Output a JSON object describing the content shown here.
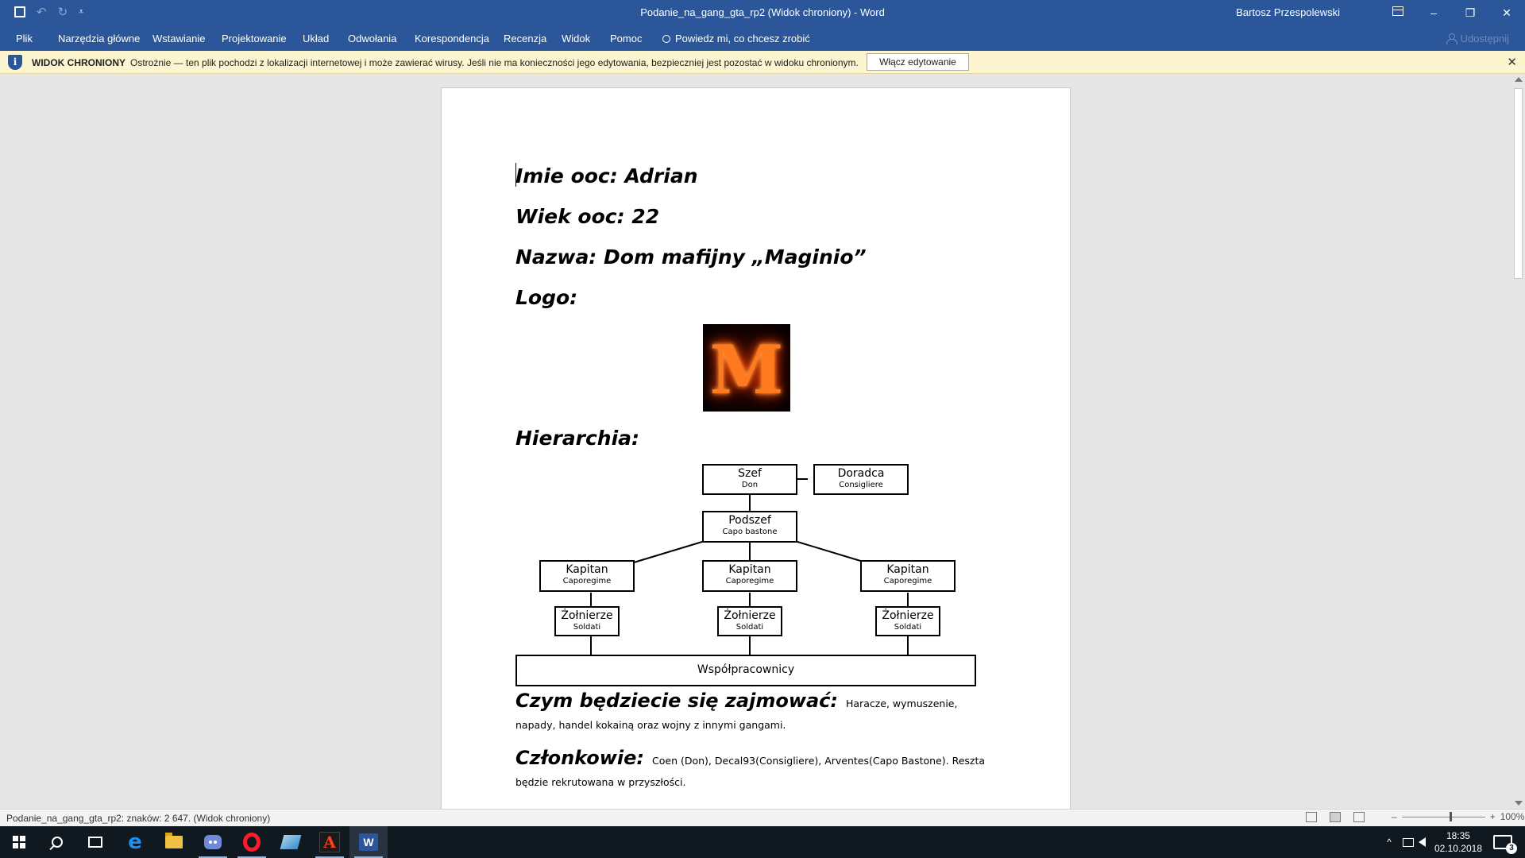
{
  "titlebar": {
    "title": "Podanie_na_gang_gta_rp2 (Widok chroniony) - Word",
    "user": "Bartosz Przespolewski",
    "minimize": "–",
    "restore": "❐",
    "close": "✕",
    "save_icon": "save-icon",
    "undo": "↶",
    "redo": "↻",
    "customize": "⩡"
  },
  "menu": {
    "items": [
      "Plik",
      "Narzędzia główne",
      "Wstawianie",
      "Projektowanie",
      "Układ",
      "Odwołania",
      "Korespondencja",
      "Recenzja",
      "Widok",
      "Pomoc"
    ],
    "tell_me": "Powiedz mi, co chcesz zrobić",
    "share": "Udostępnij"
  },
  "protected_view": {
    "title": "WIDOK CHRONIONY",
    "message": "Ostrożnie — ten plik pochodzi z lokalizacji internetowej i może zawierać wirusy. Jeśli nie ma konieczności jego edytowania, bezpieczniej jest pozostać w widoku chronionym.",
    "enable_button": "Włącz edytowanie",
    "close": "✕"
  },
  "document": {
    "lines": {
      "name": "Imie ooc: Adrian",
      "age": "Wiek ooc: 22",
      "org": "Nazwa: Dom mafijny „Maginio”",
      "logo_label": "Logo:",
      "hierarchy_label": "Hierarchia:"
    },
    "logo_letter": "M",
    "hierarchy": {
      "boss": {
        "title": "Szef",
        "sub": "Don"
      },
      "advisor": {
        "title": "Doradca",
        "sub": "Consigliere"
      },
      "underboss": {
        "title": "Podszef",
        "sub": "Capo bastone"
      },
      "captains": [
        {
          "title": "Kapitan",
          "sub": "Caporegime"
        },
        {
          "title": "Kapitan",
          "sub": "Caporegime"
        },
        {
          "title": "Kapitan",
          "sub": "Caporegime"
        }
      ],
      "soldiers": [
        {
          "title": "Żołnierze",
          "sub": "Soldati"
        },
        {
          "title": "Żołnierze",
          "sub": "Soldati"
        },
        {
          "title": "Żołnierze",
          "sub": "Soldati"
        }
      ],
      "associates": "Współpracownicy"
    },
    "activities": {
      "heading": "Czym będziecie się zajmować:",
      "text": "Haracze, wymuszenie, napady, handel kokainą oraz wojny z innymi gangami."
    },
    "members": {
      "heading": "Członkowie:",
      "text": "Coen (Don),  Decal93(Consigliere),  Arventes(Capo Bastone). Reszta będzie rekrutowana w przyszłości."
    }
  },
  "statusbar": {
    "text": "Podanie_na_gang_gta_rp2: znaków: 2 647. (Widok chroniony)",
    "zoom_out": "–",
    "zoom_in": "+",
    "zoom": "100%"
  },
  "taskbar": {
    "time": "18:35",
    "date": "02.10.2018",
    "tray_chevron": "^",
    "notifications": "3",
    "edge_glyph": "e",
    "app6_glyph": "A",
    "word_glyph": "W"
  },
  "colors": {
    "ribbon": "#2b579a",
    "protected_bar": "#fdf5cf",
    "taskbar": "#101820"
  }
}
